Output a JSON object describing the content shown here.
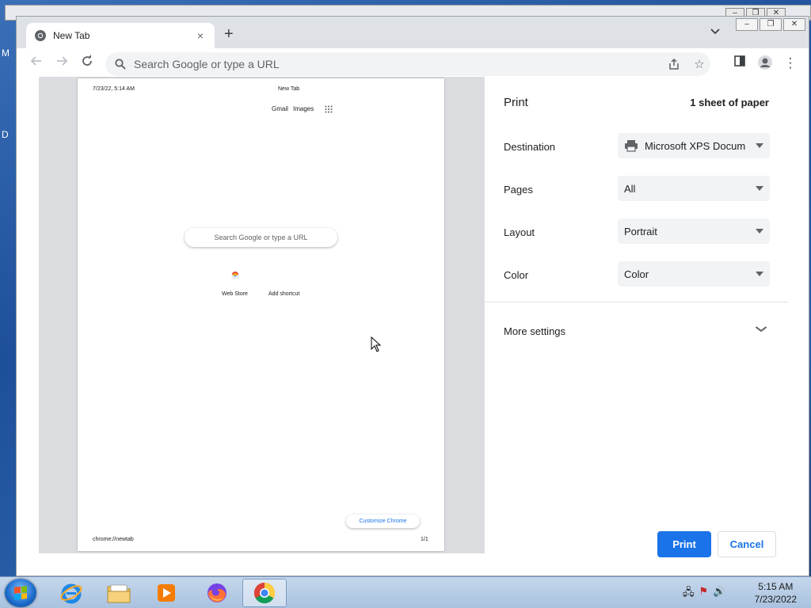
{
  "desktop": {
    "label_m": "M",
    "label_d": "D"
  },
  "chrome": {
    "tab": {
      "title": "New Tab",
      "close": "×"
    },
    "new_tab": "+",
    "tab_search": "⌄",
    "omnibox": {
      "placeholder": "Search Google or type a URL"
    }
  },
  "preview": {
    "header_date": "7/23/22, 5:14 AM",
    "header_title": "New Tab",
    "gmail": "Gmail",
    "images": "Images",
    "search": "Search Google or type a URL",
    "web_store": "Web Store",
    "add_shortcut": "Add shortcut",
    "customize": "Customize Chrome",
    "footer_url": "chrome://newtab",
    "footer_page": "1/1"
  },
  "print": {
    "title": "Print",
    "sheets": "1 sheet of paper",
    "destination_label": "Destination",
    "destination_value": "Microsoft XPS Docum",
    "pages_label": "Pages",
    "pages_value": "All",
    "layout_label": "Layout",
    "layout_value": "Portrait",
    "color_label": "Color",
    "color_value": "Color",
    "more_settings": "More settings",
    "print_button": "Print",
    "cancel_button": "Cancel",
    "accent": "#1a73e8"
  },
  "taskbar": {
    "time": "5:15 AM",
    "date": "7/23/2022",
    "apps": [
      "internet-explorer",
      "windows-explorer",
      "media-player",
      "firefox",
      "chrome"
    ]
  }
}
